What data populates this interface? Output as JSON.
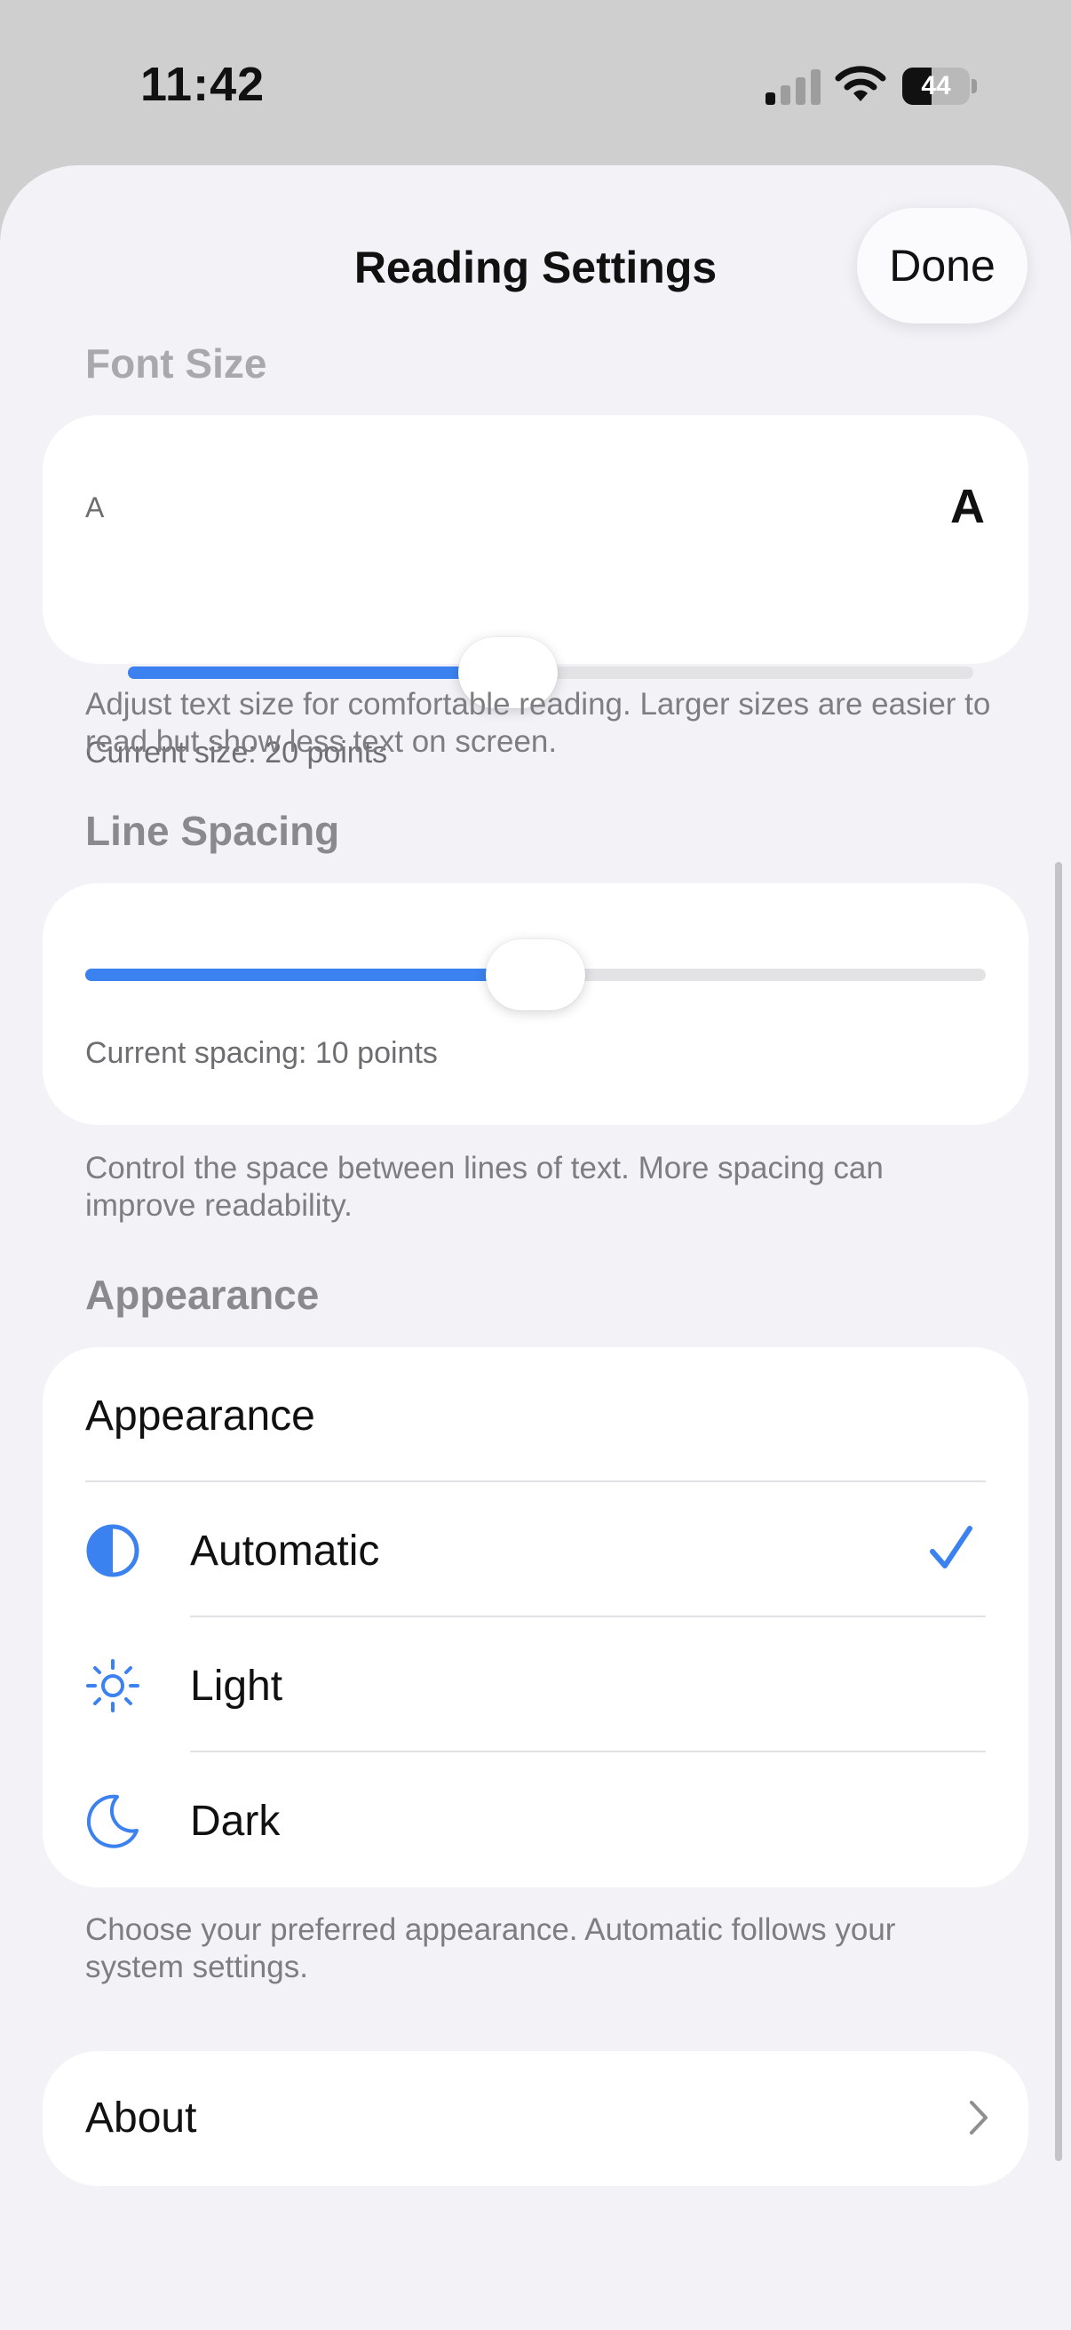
{
  "status_bar": {
    "time": "11:42",
    "battery_level": "44",
    "icons": [
      "signal-icon",
      "wifi-icon",
      "battery-icon"
    ]
  },
  "sheet": {
    "title": "Reading Settings",
    "done_label": "Done"
  },
  "font_size": {
    "header": "Font Size",
    "small_glyph": "A",
    "large_glyph": "A",
    "slider_value_fraction": 0.45,
    "caption": "Current size: 20 points",
    "footer": "Adjust text size for comfortable reading. Larger sizes are easier to read but show less text on screen."
  },
  "line_spacing": {
    "header": "Line Spacing",
    "slider_value_fraction": 0.5,
    "caption": "Current spacing: 10 points",
    "footer": "Control the space between lines of text. More spacing can improve readability."
  },
  "appearance": {
    "header": "Appearance",
    "title": "Appearance",
    "options": [
      {
        "label": "Automatic",
        "icon": "half-circle-icon",
        "selected": true
      },
      {
        "label": "Light",
        "icon": "sun-icon",
        "selected": false
      },
      {
        "label": "Dark",
        "icon": "moon-icon",
        "selected": false
      }
    ],
    "footer": "Choose your preferred appearance. Automatic follows your system settings."
  },
  "about": {
    "label": "About",
    "icon": "chevron-right-icon"
  },
  "colors": {
    "accent": "#3b82f0",
    "background": "#f2f2f7",
    "card": "#ffffff",
    "secondary_text": "#7d7d82"
  }
}
